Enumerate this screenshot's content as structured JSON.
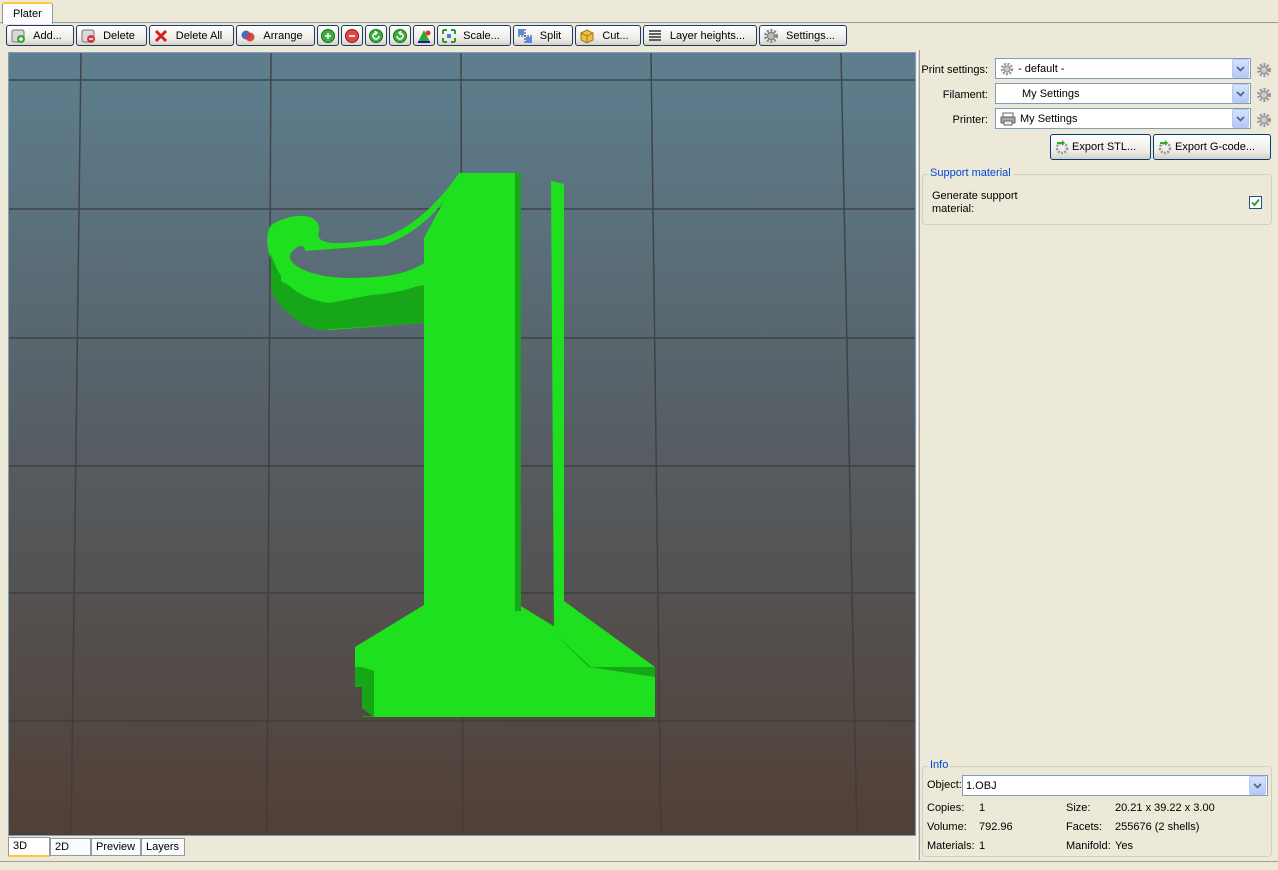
{
  "tabs": {
    "plater": "Plater"
  },
  "toolbar": {
    "add": "Add...",
    "delete": "Delete",
    "delete_all": "Delete All",
    "arrange": "Arrange",
    "scale": "Scale...",
    "split": "Split",
    "cut": "Cut...",
    "layer_heights": "Layer heights...",
    "settings": "Settings..."
  },
  "view_tabs": [
    "3D",
    "2D",
    "Preview",
    "Layers"
  ],
  "presets": {
    "print_label": "Print settings:",
    "print_value": "- default -",
    "filament_label": "Filament:",
    "filament_value": "My Settings",
    "printer_label": "Printer:",
    "printer_value": "My Settings"
  },
  "export": {
    "stl": "Export STL...",
    "gcode": "Export G-code..."
  },
  "support": {
    "title": "Support material",
    "generate_label_1": "Generate support",
    "generate_label_2": "material:",
    "generate_checked": true
  },
  "info": {
    "title": "Info",
    "object_label": "Object:",
    "object_value": "1.OBJ",
    "copies_label": "Copies:",
    "copies_value": "1",
    "size_label": "Size:",
    "size_value": "20.21 x 39.22 x 3.00",
    "volume_label": "Volume:",
    "volume_value": "792.96",
    "facets_label": "Facets:",
    "facets_value": "255676 (2 shells)",
    "materials_label": "Materials:",
    "materials_value": "1",
    "manifold_label": "Manifold:",
    "manifold_value": "Yes"
  },
  "colors": {
    "model": "#1fe01f",
    "model_dark": "#17a617",
    "accent": "#ffc83c",
    "group_title": "#0046d5"
  }
}
